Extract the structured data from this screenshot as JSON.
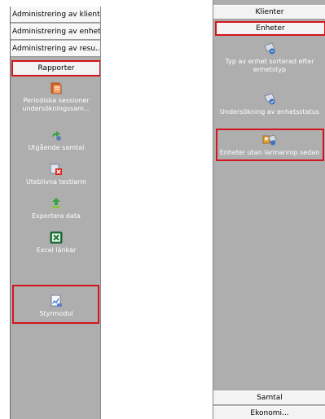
{
  "left_panel": {
    "admin_items": [
      {
        "label": "Administrering av klient"
      },
      {
        "label": "Administrering av enhet"
      },
      {
        "label": "Administrering av resu..."
      }
    ],
    "section_header": "Rapporter",
    "items": [
      {
        "label": "Periodiska sessioner undersökningssam...",
        "icon": "report-document-icon"
      },
      {
        "label": "Utgående samtal",
        "icon": "outgoing-call-icon"
      },
      {
        "label": "Uteblivna testlarm",
        "icon": "missed-test-alarm-icon"
      },
      {
        "label": "Exportera data",
        "icon": "export-data-icon"
      },
      {
        "label": "Excel länkar",
        "icon": "excel-icon"
      },
      {
        "label": "Styrmodul",
        "icon": "control-module-icon"
      }
    ]
  },
  "right_panel": {
    "headers": {
      "klienter": "Klienter",
      "enheter": "Enheter",
      "samtal": "Samtal",
      "bottom_partial": "Ekonomi..."
    },
    "items": [
      {
        "label_line1": "Typ av enhet sorterad efter",
        "label_line2": "enhetstyp",
        "icon": "device-type-icon"
      },
      {
        "label_line1": "Undersökning av enhetsstatus",
        "icon": "device-status-icon"
      },
      {
        "label_line1": "Enheter utan larmanrop sedan",
        "icon": "devices-no-alarm-icon"
      }
    ]
  },
  "colors": {
    "highlight": "#d4141c",
    "panel_bg": "#aeaeae",
    "header_bg": "#f3f3f3"
  }
}
